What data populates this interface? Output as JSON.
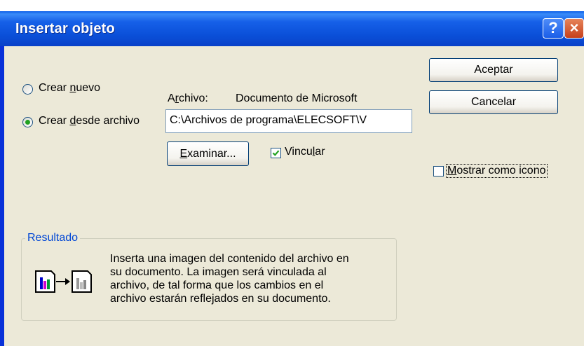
{
  "window": {
    "title": "Insertar objeto",
    "help_glyph": "?",
    "close_glyph": "×"
  },
  "options": {
    "create_new": {
      "pre": "Crear ",
      "key": "n",
      "post": "uevo",
      "selected": false
    },
    "create_from_file": {
      "pre": "Crear ",
      "key": "d",
      "post": "esde archivo",
      "selected": true
    }
  },
  "file": {
    "label_pre": "A",
    "label_key": "r",
    "label_post": "chivo:",
    "type_text": "Documento de Microsoft",
    "path": "C:\\Archivos de programa\\ELECSOFT\\V"
  },
  "browse": {
    "key": "E",
    "post": "xaminar..."
  },
  "link": {
    "pre": "Vincu",
    "key": "l",
    "post": "ar",
    "checked": true
  },
  "buttons": {
    "ok": "Aceptar",
    "cancel": "Cancelar"
  },
  "show_icon": {
    "key": "M",
    "post": "ostrar como icono",
    "checked": false
  },
  "result": {
    "title": "Resultado",
    "lines": [
      "Inserta una imagen del contenido del archivo en",
      "su documento. La imagen será vinculada al",
      "archivo, de tal forma que los cambios en el",
      "archivo estarán reflejados en su documento."
    ],
    "icons": [
      "document-chart-icon",
      "arrow-right-icon",
      "document-chart-gray-icon"
    ]
  },
  "colors": {
    "titlebar": "#0a4fd8",
    "dialog_bg": "#ece9d8",
    "radio_dot": "#21a121",
    "group_title": "#0046d5"
  }
}
